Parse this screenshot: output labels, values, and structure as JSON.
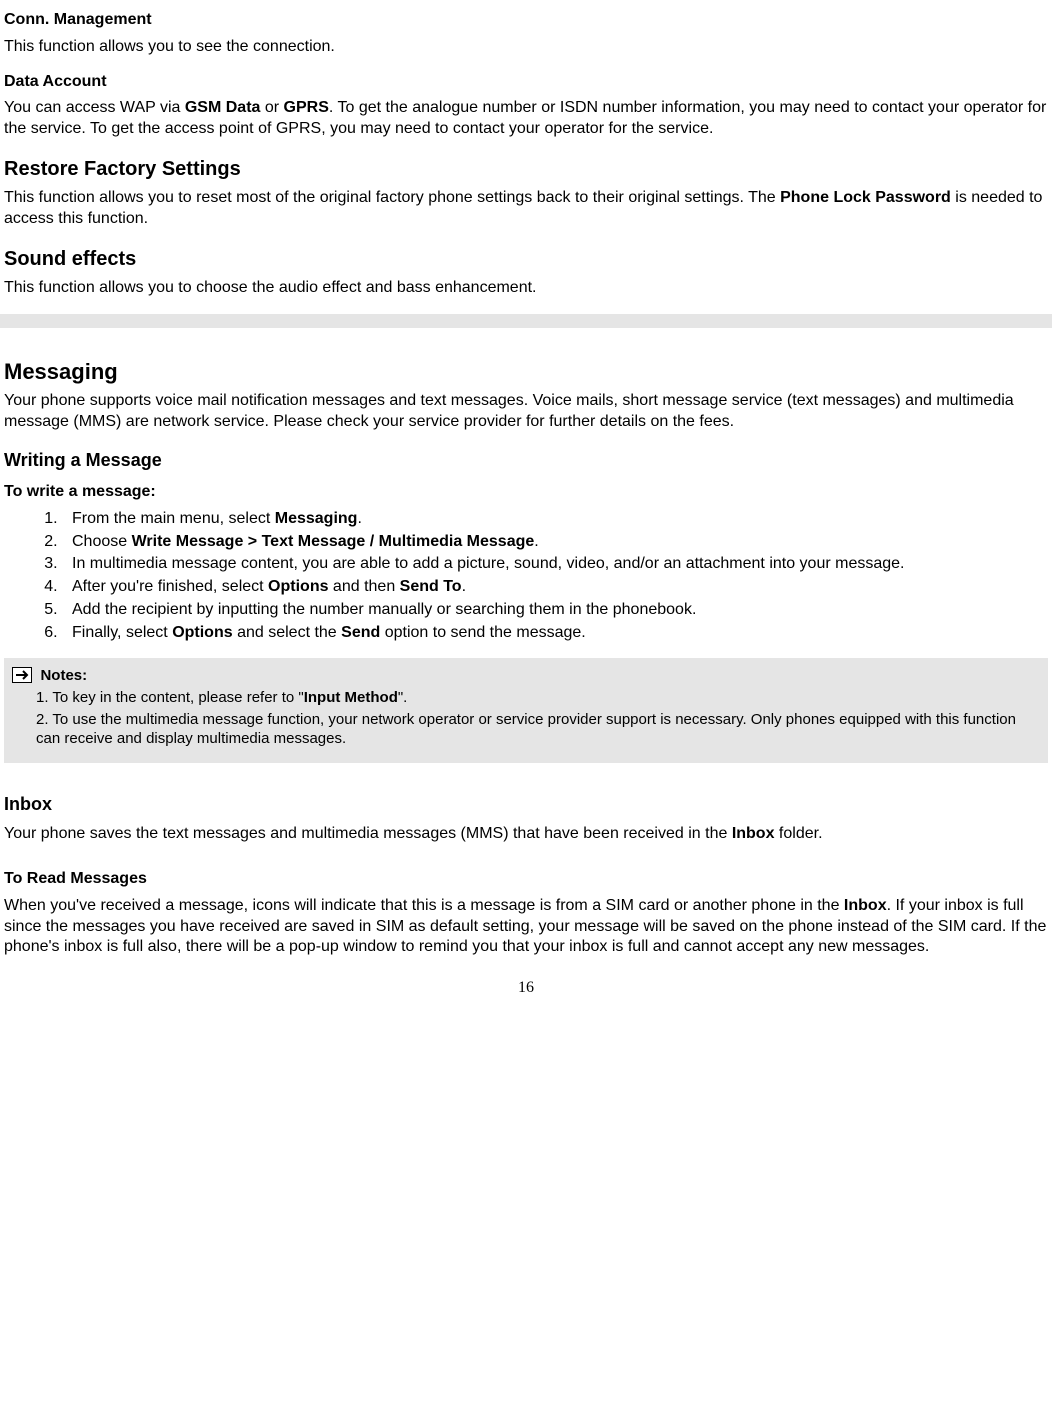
{
  "connMgmt": {
    "heading": "Conn. Management",
    "text": "This function allows you to see the connection."
  },
  "dataAccount": {
    "heading": "Data Account",
    "text_pre": "You can access WAP via ",
    "bold1": "GSM Data",
    "mid1": " or ",
    "bold2": "GPRS",
    "text_post": ". To get the analogue number or ISDN number information, you may need to contact your operator for the service. To get the access point of GPRS, you may need to contact your operator for the service."
  },
  "restoreFactory": {
    "heading": "Restore Factory Settings",
    "text_pre": "This function allows you to reset most of the original factory phone settings back to their original settings. The ",
    "bold1": "Phone Lock Password",
    "text_post": " is needed to access this function."
  },
  "soundEffects": {
    "heading": "Sound effects",
    "text": "This function allows you to choose the audio effect and bass enhancement."
  },
  "messaging": {
    "heading": "Messaging",
    "text": "Your phone supports voice mail notification messages and text messages. Voice mails, short message service (text messages) and multimedia message (MMS) are network service. Please check your service provider for further details on the fees."
  },
  "writing": {
    "heading": "Writing a Message",
    "subheading": "To write a message:",
    "steps": {
      "s1_pre": "From the main menu, select ",
      "s1_b1": "Messaging",
      "s1_post": ".",
      "s2_pre": "Choose ",
      "s2_b1": "Write Message > Text Message / Multimedia Message",
      "s2_post": ".",
      "s3": "In multimedia message content, you are able to add a picture, sound, video, and/or an attachment into your message.",
      "s4_pre": "After you're finished, select ",
      "s4_b1": "Options",
      "s4_mid": " and then ",
      "s4_b2": "Send To",
      "s4_post": ".",
      "s5": "Add the recipient by inputting the number manually or searching them in the phonebook.",
      "s6_pre": "Finally, select ",
      "s6_b1": "Options",
      "s6_mid": " and select the ",
      "s6_b2": "Send",
      "s6_post": " option to send the message."
    }
  },
  "notes": {
    "title": "Notes:",
    "n1_pre": "1. To key in the content, please refer to \"",
    "n1_b1": "Input Method",
    "n1_post": "\".",
    "n2": "2. To use the multimedia message function, your network operator or service provider support is necessary. Only phones equipped with this function can receive and display multimedia messages."
  },
  "inbox": {
    "heading": "Inbox",
    "text_pre": "Your phone saves the text messages and multimedia messages (MMS) that have been received in the ",
    "bold1": "Inbox",
    "text_post": " folder."
  },
  "toRead": {
    "heading": "To Read Messages",
    "text_pre": "When you've received a message, icons will indicate that this is a message is from a SIM card or another phone in the ",
    "bold1": "Inbox",
    "text_post": ". If your inbox is full since the messages you have received are saved in SIM as default setting, your message will be saved on the phone instead of the SIM card. If the phone's inbox is full also, there will be a pop-up window to remind you that your inbox is full and cannot accept any new messages."
  },
  "pageNumber": "16"
}
